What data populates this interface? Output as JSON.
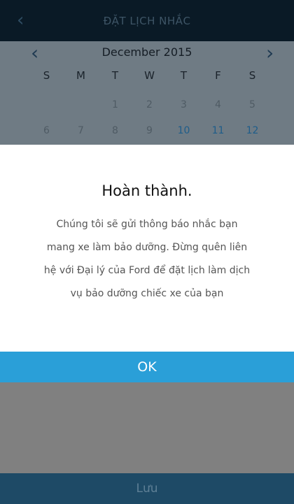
{
  "header": {
    "title": "ĐẶT LỊCH NHẮC",
    "back_icon": "chevron-left-icon"
  },
  "calendar": {
    "month_label": "December 2015",
    "prev_icon": "chevron-left-icon",
    "next_icon": "chevron-right-icon",
    "day_headers": [
      "S",
      "M",
      "T",
      "W",
      "T",
      "F",
      "S"
    ],
    "weeks": [
      [
        "",
        "",
        "1",
        "2",
        "3",
        "4",
        "5"
      ],
      [
        "6",
        "7",
        "8",
        "9",
        "10",
        "11",
        "12"
      ]
    ],
    "highlighted_days": [
      "10",
      "11",
      "12"
    ]
  },
  "dialog": {
    "heading": "Hoàn thành.",
    "message": "Chúng tôi sẽ gửi thông báo nhắc bạn mang xe làm bảo dưỡng. Đừng quên liên hệ với Đại lý của Ford để đặt lịch làm dịch vụ bảo dưỡng chiếc xe của bạn",
    "ok_label": "OK"
  },
  "footer": {
    "save_label": "Lưu"
  },
  "colors": {
    "accent": "#2a9fd8",
    "header_bg": "#0a1a26",
    "footer_bg": "#1e4a66"
  }
}
